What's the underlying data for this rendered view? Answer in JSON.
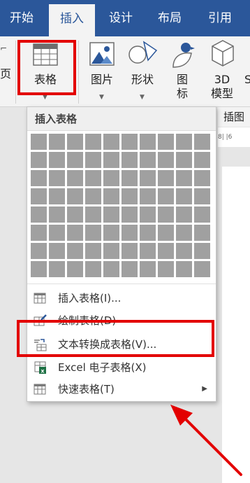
{
  "ribbon_tabs": [
    {
      "label": "开始",
      "active": false
    },
    {
      "label": "插入",
      "active": true
    },
    {
      "label": "设计",
      "active": false
    },
    {
      "label": "布局",
      "active": false
    },
    {
      "label": "引用",
      "active": false
    }
  ],
  "ribbon_left_partial": "页",
  "ribbon_buttons": {
    "table": {
      "label": "表格"
    },
    "pictures": {
      "label": "图片"
    },
    "shapes": {
      "label": "形状"
    },
    "icons": {
      "label_line1": "图",
      "label_line2": "标"
    },
    "models3d": {
      "label_line1": "3D",
      "label_line2": "模型"
    },
    "partial": {
      "label": "S"
    }
  },
  "group_label": "插图",
  "ruler_text": "8|  |6",
  "dropdown": {
    "header": "插入表格",
    "grid": {
      "rows": 8,
      "cols": 10
    },
    "items": [
      {
        "label": "插入表格(I)...",
        "icon": "table-insert-icon"
      },
      {
        "label": "绘制表格(D)",
        "icon": "pencil-table-icon"
      },
      {
        "label": "文本转换成表格(V)...",
        "icon": "text-to-table-icon"
      },
      {
        "label": "Excel 电子表格(X)",
        "icon": "excel-icon"
      },
      {
        "label": "快速表格(T)",
        "icon": "quick-table-icon",
        "submenu": true
      }
    ]
  },
  "colors": {
    "tabbar": "#2b579a",
    "highlight": "#e30000",
    "grid_cell": "#a0a0a0"
  }
}
